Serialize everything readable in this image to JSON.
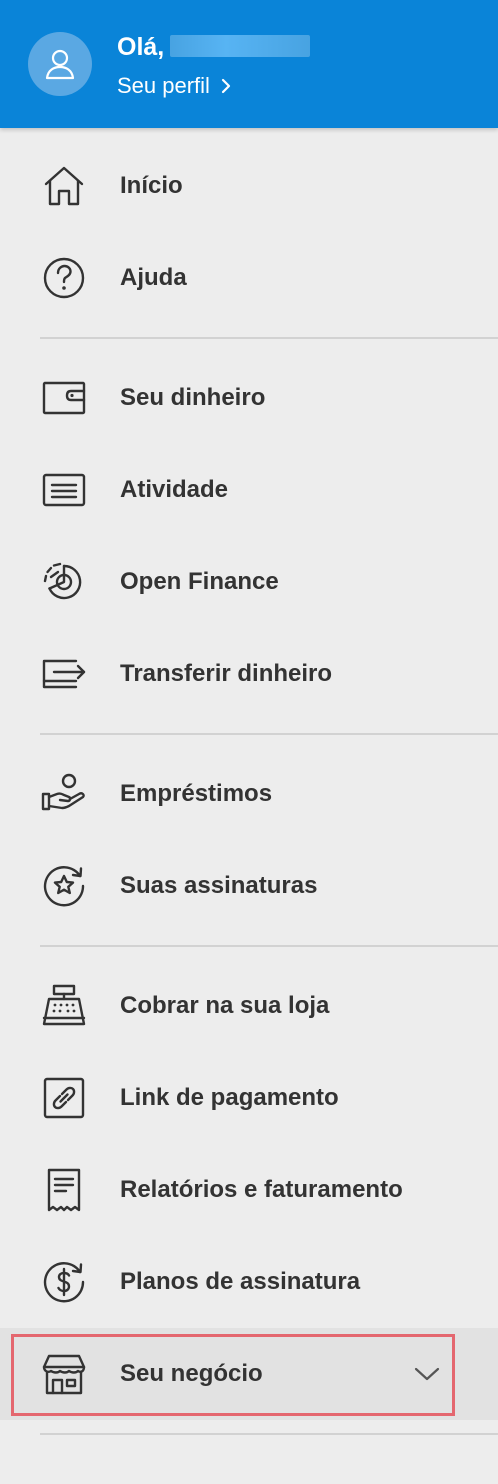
{
  "header": {
    "greeting": "Olá,",
    "profile_link": "Seu perfil"
  },
  "menu": {
    "group1": [
      {
        "label": "Início",
        "icon": "home-icon"
      },
      {
        "label": "Ajuda",
        "icon": "help-icon"
      }
    ],
    "group2": [
      {
        "label": "Seu dinheiro",
        "icon": "wallet-icon"
      },
      {
        "label": "Atividade",
        "icon": "activity-icon"
      },
      {
        "label": "Open Finance",
        "icon": "open-finance-icon"
      },
      {
        "label": "Transferir dinheiro",
        "icon": "transfer-icon"
      }
    ],
    "group3": [
      {
        "label": "Empréstimos",
        "icon": "loan-icon"
      },
      {
        "label": "Suas assinaturas",
        "icon": "subscriptions-icon"
      }
    ],
    "group4": [
      {
        "label": "Cobrar na sua loja",
        "icon": "cash-register-icon"
      },
      {
        "label": "Link de pagamento",
        "icon": "payment-link-icon"
      },
      {
        "label": "Relatórios e faturamento",
        "icon": "receipt-icon"
      },
      {
        "label": "Planos de assinatura",
        "icon": "dollar-cycle-icon"
      },
      {
        "label": "Seu negócio",
        "icon": "store-icon"
      }
    ]
  },
  "colors": {
    "header_bg": "#0a84d8",
    "highlight_border": "#e4676f",
    "text": "#333333",
    "background": "#ededed"
  }
}
